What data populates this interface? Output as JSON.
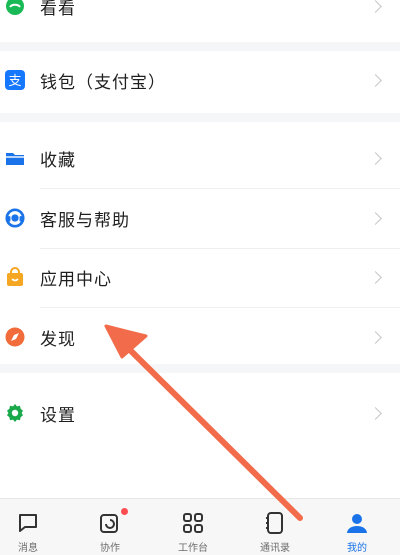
{
  "menu": {
    "kankan": "看看",
    "wallet": "钱包（支付宝）",
    "favorites": "收藏",
    "support": "客服与帮助",
    "appcenter": "应用中心",
    "discover": "发现",
    "settings": "设置"
  },
  "tabs": {
    "messages": "消息",
    "collab": "协作",
    "workbench": "工作台",
    "contacts": "通讯录",
    "mine": "我的"
  },
  "colors": {
    "accent": "#1a73e8",
    "arrow": "#f26b4a",
    "badge": "#ff4d4f"
  }
}
